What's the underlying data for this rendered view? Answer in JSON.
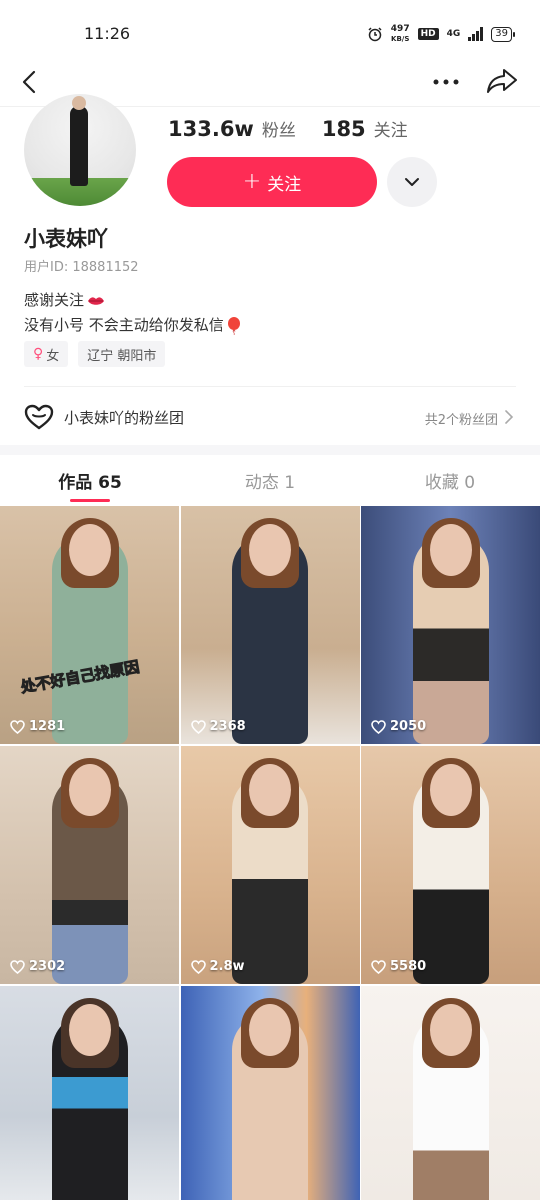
{
  "status_bar": {
    "time": "11:26",
    "net_speed_value": "497",
    "net_speed_unit": "KB/S",
    "hd_label": "HD",
    "network": "4G",
    "battery": "39"
  },
  "profile": {
    "followers_count": "133.6w",
    "followers_label": "粉丝",
    "following_count": "185",
    "following_label": "关注",
    "follow_button_label": "关注",
    "nickname": "小表妹吖",
    "user_id": "用户ID: 18881152",
    "bio_line_1": "感谢关注",
    "bio_line_2": "没有小号 不会主动给你发私信",
    "tags": [
      {
        "label": "女"
      },
      {
        "label": "辽宁 朝阳市"
      }
    ],
    "fan_club_title": "小表妹吖的粉丝团",
    "fan_club_count": "共2个粉丝团"
  },
  "tabs": [
    {
      "label": "作品 65",
      "active": true
    },
    {
      "label": "动态 1",
      "active": false
    },
    {
      "label": "收藏 0",
      "active": false
    }
  ],
  "videos": [
    {
      "likes": "1281",
      "overlay": "处不好自己找原因"
    },
    {
      "likes": "2368"
    },
    {
      "likes": "2050"
    },
    {
      "likes": "2302"
    },
    {
      "likes": "2.8w"
    },
    {
      "likes": "5580"
    },
    {
      "likes": ""
    },
    {
      "likes": ""
    },
    {
      "likes": ""
    }
  ],
  "colors": {
    "accent": "#fe2c55",
    "text_primary": "#222222",
    "text_secondary": "#999999"
  }
}
